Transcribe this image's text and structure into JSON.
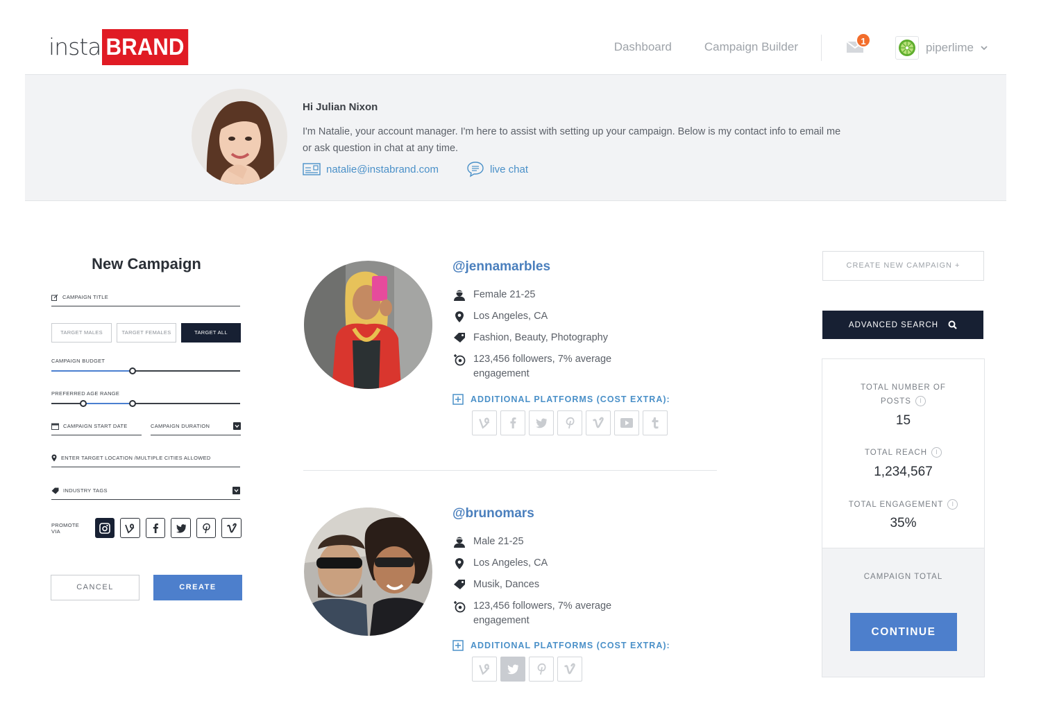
{
  "header": {
    "logo_insta": "insta",
    "logo_brand": "BRAND",
    "nav": [
      "Dashboard",
      "Campaign Builder"
    ],
    "mail_badge": "1",
    "username": "piperlime"
  },
  "account_manager": {
    "greeting": "Hi Julian Nixon",
    "intro": "I'm Natalie, your account manager. I'm here to assist with setting up your campaign. Below is my contact info to email me or ask question in chat at any time.",
    "email": "natalie@instabrand.com",
    "chat": "live chat"
  },
  "form": {
    "title": "New Campaign",
    "campaign_title_label": "Campaign Title",
    "target_buttons": [
      "Target Males",
      "Target Females",
      "Target All"
    ],
    "target_selected": "Target All",
    "budget_label": "Campaign Budget",
    "budget_level": 0.43,
    "age_label": "Preferred Age Range",
    "age_range_low": 0.17,
    "age_range_high": 0.43,
    "start_date_label": "Campaign Start Date",
    "duration_label": "Campaign Duration",
    "location_label": "Enter target location /multiple cities allowed",
    "industry_label": "Industry Tags",
    "promote_label": "Promote via",
    "promote_icons": [
      "instagram-icon",
      "vine-icon",
      "facebook-icon",
      "twitter-icon",
      "pinterest-icon",
      "vimeo-icon"
    ],
    "cancel": "Cancel",
    "create": "Create"
  },
  "influencers": [
    {
      "handle": "@jennamarbles",
      "demographic": "Female 21-25",
      "location": "Los Angeles, CA",
      "tags": "Fashion, Beauty, Photography",
      "stats": "123,456 followers, 7% average engagement",
      "additional_label": "Additional Platforms (Cost Extra):",
      "platforms": [
        "vine-icon",
        "facebook-icon",
        "twitter-icon",
        "pinterest-icon",
        "vimeo-icon",
        "youtube-icon",
        "tumblr-icon"
      ]
    },
    {
      "handle": "@brunomars",
      "demographic": "Male 21-25",
      "location": "Los Angeles, CA",
      "tags": "Musik, Dances",
      "stats": "123,456 followers, 7% average engagement",
      "additional_label": "Additional Platforms (Cost Extra):",
      "platforms": [
        "vine-icon",
        "twitter-icon",
        "pinterest-icon",
        "vimeo-icon"
      ],
      "selected_platform": "twitter-icon"
    }
  ],
  "sidebar": {
    "create_new": "Create New Campaign +",
    "advanced_search": "Advanced Search",
    "posts_label": "Total Number of Posts",
    "posts_value": "15",
    "reach_label": "Total Reach",
    "reach_value": "1,234,567",
    "engagement_label": "Total Engagement",
    "engagement_value": "35%",
    "total_label": "Campaign Total",
    "continue": "Continue"
  },
  "colors": {
    "brand_red": "#e01b24",
    "navy": "#172033",
    "accent_blue": "#4d7fcc",
    "link_blue": "#4a90c8",
    "badge_orange": "#f26d2b"
  }
}
